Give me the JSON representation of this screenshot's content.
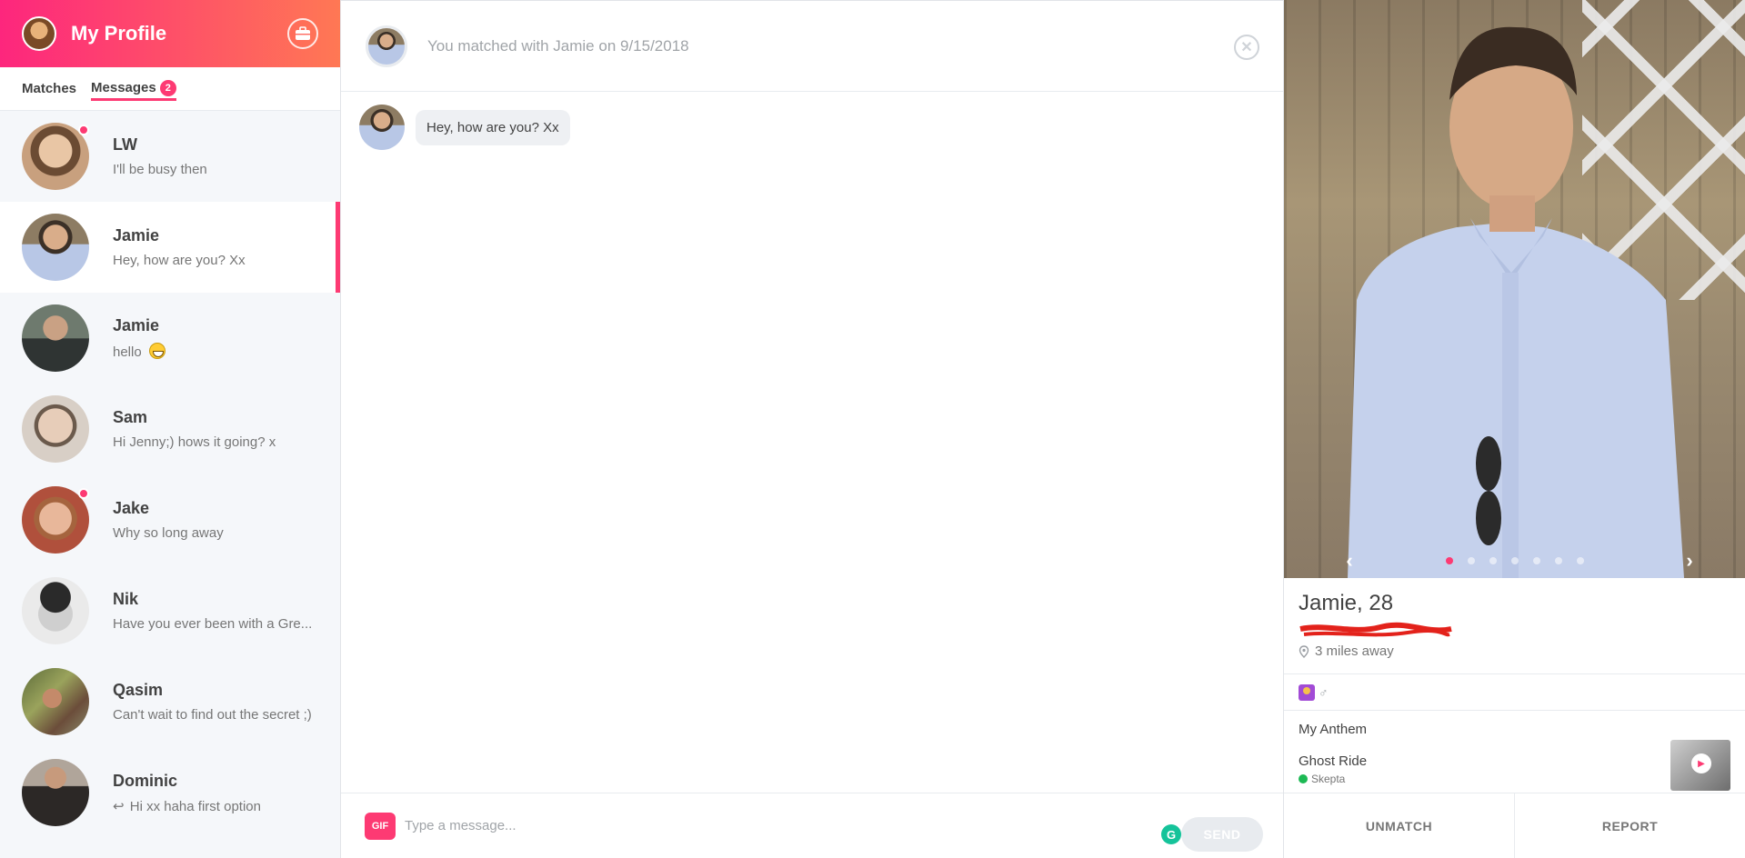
{
  "header": {
    "title": "My Profile",
    "icon": "briefcase-icon"
  },
  "tabs": [
    {
      "label": "Matches"
    },
    {
      "label": "Messages",
      "badge": "2"
    }
  ],
  "matches": [
    {
      "name": "LW",
      "message": "I'll be busy then",
      "unread": true,
      "avatar_color": "#c8a07e"
    },
    {
      "name": "Jamie",
      "message": "Hey, how are you? Xx",
      "selected": true,
      "avatar_color": "#8aa3c8"
    },
    {
      "name": "Jamie",
      "message": "hello",
      "emoji": "grinning-face",
      "avatar_color": "#556b5a"
    },
    {
      "name": "Sam",
      "message": "Hi Jenny;) hows it going? x",
      "avatar_color": "#c9b6a4"
    },
    {
      "name": "Jake",
      "message": "Why so long away",
      "unread": true,
      "avatar_color": "#b0503c"
    },
    {
      "name": "Nik",
      "message": "Have you ever been with a Gre...",
      "avatar_color": "#9a9a9a"
    },
    {
      "name": "Qasim",
      "message": "Can't wait to find out the secret ;)",
      "avatar_color": "#7d8a4e"
    },
    {
      "name": "Dominic",
      "message": "Hi xx haha first option",
      "reply_icon": "reply-arrow-icon",
      "avatar_color": "#5a4a44"
    }
  ],
  "chat": {
    "matched_text": "You matched with Jamie on 9/15/2018",
    "messages": [
      {
        "text": "Hey, how are you? Xx"
      }
    ],
    "composer": {
      "gif_label": "GIF",
      "placeholder": "Type a message...",
      "grammarly_label": "G",
      "send_label": "SEND"
    }
  },
  "profile": {
    "name_age": "Jamie, 28",
    "distance": "3 miles away",
    "photo_count": 7,
    "photo_index": 0,
    "anthem_title": "My Anthem",
    "song": "Ghost Ride",
    "artist": "Skepta",
    "gender_symbol": "♂",
    "unmatch_label": "UNMATCH",
    "report_label": "REPORT"
  },
  "colors": {
    "brand_pink": "#fd3a73",
    "gradient_start": "#fd267d",
    "gradient_end": "#ff7854"
  }
}
